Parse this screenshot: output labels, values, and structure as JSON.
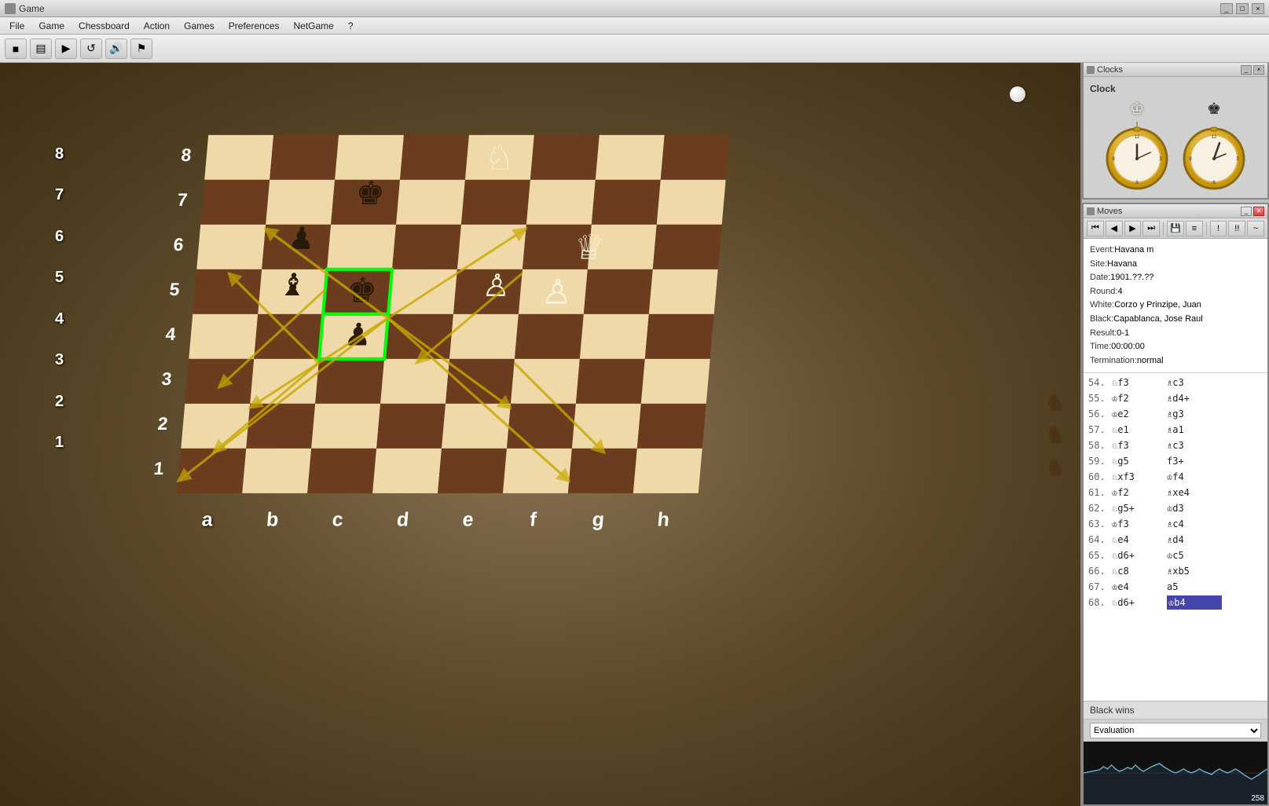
{
  "app": {
    "title": "Game",
    "clock_title": "Clocks"
  },
  "menu": {
    "items": [
      "File",
      "Game",
      "Chessboard",
      "Action",
      "Games",
      "Preferences",
      "NetGame",
      "?"
    ]
  },
  "toolbar": {
    "buttons": [
      "■",
      "▤",
      "▶",
      "↺",
      "🔊",
      "⚠"
    ]
  },
  "clock": {
    "label": "Clock",
    "white_king": "♔",
    "black_king": "♚"
  },
  "moves_panel": {
    "title": "Moves",
    "nav_buttons": [
      "⏮",
      "◀",
      "▶",
      "⏭",
      "💾",
      "≡",
      "!",
      "!!",
      "~"
    ],
    "game_info": {
      "event_label": "Event:",
      "event_value": "Havana m",
      "site_label": "Site:",
      "site_value": "Havana",
      "date_label": "Date:",
      "date_value": "1901.??.??",
      "round_label": "Round:",
      "round_value": "4",
      "white_label": "White:",
      "white_value": "Corzo y Prinzipe, Juan",
      "black_label": "Black:",
      "black_value": "Capablanca, Jose Raul",
      "result_label": "Result:",
      "result_value": "0-1",
      "time_label": "Time:",
      "time_value": "00:00:00",
      "term_label": "Termination:",
      "term_value": "normal"
    },
    "moves": [
      {
        "num": "54.",
        "white": "♘f3",
        "black": "♗c3"
      },
      {
        "num": "55.",
        "white": "♔f2",
        "black": "♗d4+"
      },
      {
        "num": "56.",
        "white": "♔e2",
        "black": "♗g3"
      },
      {
        "num": "57.",
        "white": "♘e1",
        "black": "♗a1"
      },
      {
        "num": "58.",
        "white": "♘f3",
        "black": "♗c3"
      },
      {
        "num": "59.",
        "white": "♘g5",
        "black": "f3+"
      },
      {
        "num": "60.",
        "white": "♘xf3",
        "black": "♔f4"
      },
      {
        "num": "61.",
        "white": "♔f2",
        "black": "♗xe4"
      },
      {
        "num": "62.",
        "white": "♘g5+",
        "black": "♔d3"
      },
      {
        "num": "63.",
        "white": "♔f3",
        "black": "♗c4"
      },
      {
        "num": "64.",
        "white": "♘e4",
        "black": "♗d4"
      },
      {
        "num": "65.",
        "white": "♘d6+",
        "black": "♔c5"
      },
      {
        "num": "66.",
        "white": "♘c8",
        "black": "♗xb5"
      },
      {
        "num": "67.",
        "white": "♔e4",
        "black": "a5"
      },
      {
        "num": "68.",
        "white": "♘d6+",
        "black": "♔b4",
        "current": true
      }
    ],
    "result": "Black wins",
    "eval_label": "Evaluation",
    "eval_number": "258"
  },
  "board": {
    "ranks": [
      "8",
      "7",
      "6",
      "5",
      "4",
      "3",
      "2",
      "1"
    ],
    "files": [
      "a",
      "b",
      "c",
      "d",
      "e",
      "f",
      "g",
      "h"
    ]
  }
}
